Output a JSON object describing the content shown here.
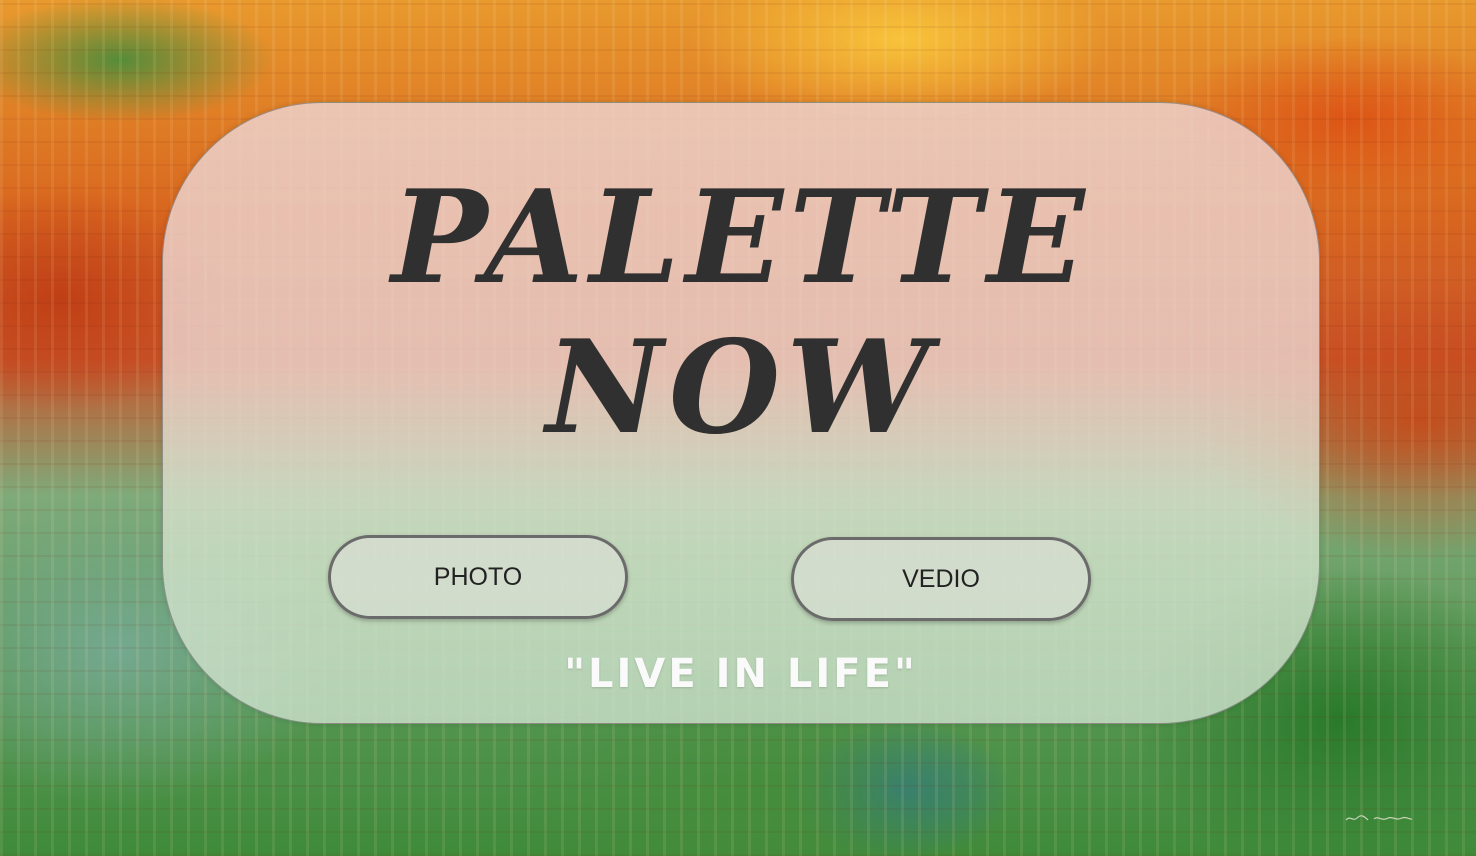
{
  "hero": {
    "title_line1": "PALETTE",
    "title_line2": "NOW",
    "buttons": {
      "photo_label": "PHOTO",
      "video_label": "VEDIO"
    },
    "tagline": "\"LIVE IN LIFE\""
  },
  "colors": {
    "title_text": "#303030",
    "button_border": "#6b6b6b",
    "tagline_text": "#fafafa"
  }
}
